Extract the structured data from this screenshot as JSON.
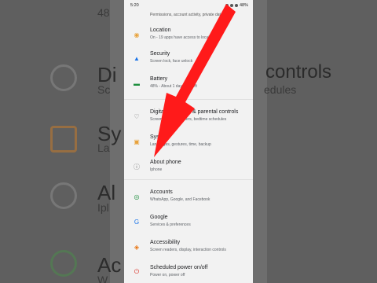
{
  "status_bar": {
    "time": "5:20",
    "battery": "48%"
  },
  "partial_row": {
    "subtitle": "Permissions, account activity, private data"
  },
  "settings_items": [
    {
      "title": "Location",
      "subtitle": "On - 19 apps have access to location",
      "icon": "location-icon",
      "color": "#e8a23b"
    },
    {
      "title": "Security",
      "subtitle": "Screen lock, face unlock",
      "icon": "shield-icon",
      "color": "#1a73e8"
    },
    {
      "title": "Battery",
      "subtitle": "48% - About 1 day, 2 hr left",
      "icon": "battery-icon",
      "color": "#1e8e3e"
    },
    {
      "title": "Digital Wellbeing & parental controls",
      "subtitle": "Screen time, app timers, bedtime schedules",
      "icon": "wellbeing-icon",
      "color": "#777777"
    },
    {
      "title": "System",
      "subtitle": "Languages, gestures, time, backup",
      "icon": "system-icon",
      "color": "#e8a23b"
    },
    {
      "title": "About phone",
      "subtitle": "Iphone",
      "icon": "info-icon",
      "color": "#777777"
    },
    {
      "title": "Accounts",
      "subtitle": "WhatsApp, Google, and Facebook",
      "icon": "accounts-icon",
      "color": "#1e8e3e"
    },
    {
      "title": "Google",
      "subtitle": "Services & preferences",
      "icon": "google-icon",
      "color": "#1a73e8"
    },
    {
      "title": "Accessibility",
      "subtitle": "Screen readers, display, interaction controls",
      "icon": "accessibility-icon",
      "color": "#e8710a"
    },
    {
      "title": "Scheduled power on/off",
      "subtitle": "Power on, power off",
      "icon": "power-icon",
      "color": "#d93025"
    }
  ],
  "background": {
    "row1_title": "Di",
    "row1_title_right": "controls",
    "row1_sub": "Sc",
    "row1_sub_right": "edules",
    "row2_title": "Sy",
    "row2_sub": "La",
    "row3_title": "Al",
    "row3_sub": "Ipl",
    "row4_title": "Ac",
    "row4_sub": "W",
    "top_number": "48"
  }
}
